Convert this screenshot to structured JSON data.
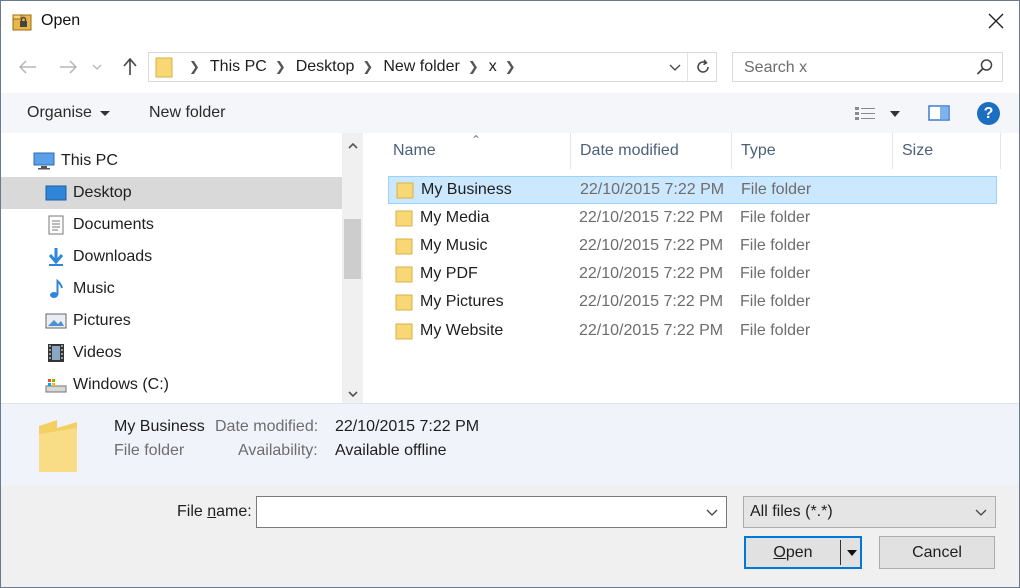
{
  "window": {
    "title": "Open",
    "close_icon": "close-icon"
  },
  "navigation": {
    "breadcrumbs": [
      "This PC",
      "Desktop",
      "New folder",
      "x"
    ],
    "search_placeholder": "Search x"
  },
  "toolbar": {
    "organise_label": "Organise",
    "new_folder_label": "New folder",
    "help_label": "?"
  },
  "nav_pane": {
    "items": [
      {
        "label": "This PC",
        "icon": "computer-icon",
        "selected": false
      },
      {
        "label": "Desktop",
        "icon": "desktop-icon",
        "selected": true
      },
      {
        "label": "Documents",
        "icon": "documents-icon",
        "selected": false
      },
      {
        "label": "Downloads",
        "icon": "downloads-icon",
        "selected": false
      },
      {
        "label": "Music",
        "icon": "music-icon",
        "selected": false
      },
      {
        "label": "Pictures",
        "icon": "pictures-icon",
        "selected": false
      },
      {
        "label": "Videos",
        "icon": "videos-icon",
        "selected": false
      },
      {
        "label": "Windows (C:)",
        "icon": "drive-icon",
        "selected": false
      }
    ]
  },
  "file_list": {
    "columns": [
      "Name",
      "Date modified",
      "Type",
      "Size"
    ],
    "rows": [
      {
        "name": "My Business",
        "date": "22/10/2015 7:22 PM",
        "type": "File folder",
        "selected": true
      },
      {
        "name": "My Media",
        "date": "22/10/2015 7:22 PM",
        "type": "File folder",
        "selected": false
      },
      {
        "name": "My Music",
        "date": "22/10/2015 7:22 PM",
        "type": "File folder",
        "selected": false
      },
      {
        "name": "My PDF",
        "date": "22/10/2015 7:22 PM",
        "type": "File folder",
        "selected": false
      },
      {
        "name": "My Pictures",
        "date": "22/10/2015 7:22 PM",
        "type": "File folder",
        "selected": false
      },
      {
        "name": "My Website",
        "date": "22/10/2015 7:22 PM",
        "type": "File folder",
        "selected": false
      }
    ]
  },
  "details": {
    "name": "My Business",
    "type": "File folder",
    "date_label": "Date modified:",
    "date_value": "22/10/2015 7:22 PM",
    "availability_label": "Availability:",
    "availability_value": "Available offline"
  },
  "footer": {
    "file_name_label_pre": "File ",
    "file_name_label_accel": "n",
    "file_name_label_post": "ame:",
    "file_name_value": "",
    "file_type_value": "All files (*.*)",
    "open_label_accel": "O",
    "open_label_post": "pen",
    "cancel_label": "Cancel"
  },
  "colors": {
    "accent": "#0078d7",
    "selection_bg": "#cce8ff",
    "selection_border": "#99d1ff",
    "folder_yellow": "#f8d775",
    "nav_selected": "#d9d9d9",
    "details_bg": "#f0f4fa"
  }
}
